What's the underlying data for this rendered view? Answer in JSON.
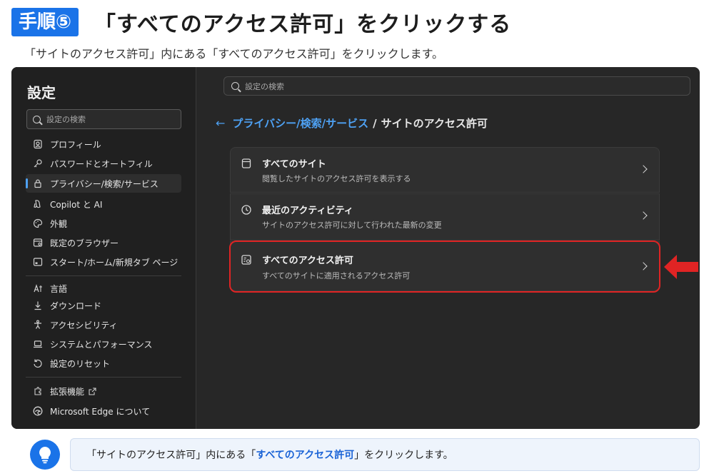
{
  "step": {
    "badge": "手順⑤",
    "title": "「すべてのアクセス許可」をクリックする",
    "description": "「サイトのアクセス許可」内にある「すべてのアクセス許可」をクリックします。"
  },
  "sidebar": {
    "title": "設定",
    "search_placeholder": "設定の検索",
    "items": [
      {
        "label": "プロフィール",
        "icon": "profile-icon"
      },
      {
        "label": "パスワードとオートフィル",
        "icon": "key-icon"
      },
      {
        "label": "プライバシー/検索/サービス",
        "icon": "lock-icon",
        "active": true
      },
      {
        "label": "Copilot と AI",
        "icon": "copilot-icon"
      },
      {
        "label": "外観",
        "icon": "palette-icon"
      },
      {
        "label": "既定のブラウザー",
        "icon": "browser-icon"
      },
      {
        "label": "スタート/ホーム/新規タブ ページ",
        "icon": "home-tab-icon"
      },
      {
        "label": "言語",
        "icon": "language-icon"
      },
      {
        "label": "ダウンロード",
        "icon": "download-icon"
      },
      {
        "label": "アクセシビリティ",
        "icon": "accessibility-icon"
      },
      {
        "label": "システムとパフォーマンス",
        "icon": "laptop-icon"
      },
      {
        "label": "設定のリセット",
        "icon": "reset-icon"
      },
      {
        "label": "拡張機能",
        "icon": "extension-icon"
      },
      {
        "label": "Microsoft Edge について",
        "icon": "edge-logo-icon"
      }
    ]
  },
  "main": {
    "search_placeholder": "設定の検索",
    "breadcrumb": {
      "parent": "プライバシー/検索/サービス",
      "separator": "/",
      "current": "サイトのアクセス許可"
    },
    "rows": [
      {
        "title": "すべてのサイト",
        "subtitle": "閲覧したサイトのアクセス許可を表示する",
        "icon": "site-icon"
      },
      {
        "title": "最近のアクティビティ",
        "subtitle": "サイトのアクセス許可に対して行われた最新の変更",
        "icon": "clock-icon"
      },
      {
        "title": "すべてのアクセス許可",
        "subtitle": "すべてのサイトに適用されるアクセス許可",
        "icon": "permissions-icon"
      }
    ]
  },
  "tip": {
    "prefix": "「サイトのアクセス許可」内にある「",
    "highlight": "すべてのアクセス許可",
    "suffix": "」をクリックします。",
    "icon": "lightbulb-icon"
  },
  "colors": {
    "accent": "#1a73e8",
    "link": "#4ea1f3",
    "highlight_border": "#e02424",
    "window_bg": "#272727"
  }
}
